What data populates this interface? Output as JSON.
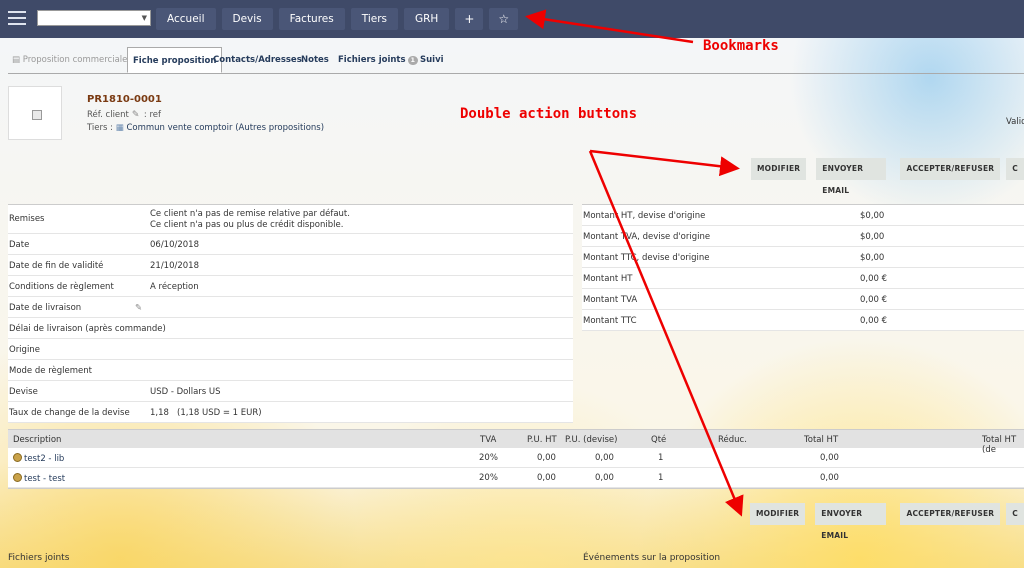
{
  "topbar": {
    "menu": [
      "Accueil",
      "Devis",
      "Factures",
      "Tiers",
      "GRH"
    ],
    "add": "+",
    "bookmark": "☆"
  },
  "tabs": {
    "t1": "Proposition commerciale",
    "t2": "Fiche proposition",
    "t3": "Contacts/Adresses",
    "t4": "Notes",
    "t5": "Fichiers joints",
    "t5_badge": "1",
    "t6": "Suivi"
  },
  "header": {
    "ref": "PR1810-0001",
    "ref_client_label": "Réf. client",
    "ref_client_value": ": ref",
    "tiers_label": "Tiers :",
    "tiers_name": "Commun vente comptoir",
    "tiers_link": "(Autres propositions)",
    "status": "Valid"
  },
  "actions": {
    "modifier": "MODIFIER",
    "envoyer": "ENVOYER EMAIL",
    "accepter": "ACCEPTER/REFUSER",
    "more": "C"
  },
  "info": {
    "remises_label": "Remises",
    "remises_v1": "Ce client n'a pas de remise relative par défaut.",
    "remises_v2": "Ce client n'a pas ou plus de crédit disponible.",
    "date_label": "Date",
    "date": "06/10/2018",
    "fin_label": "Date de fin de validité",
    "fin": "21/10/2018",
    "cond_label": "Conditions de règlement",
    "cond": "A réception",
    "livr_label": "Date de livraison",
    "delai_label": "Délai de livraison (après commande)",
    "origine_label": "Origine",
    "mode_label": "Mode de règlement",
    "devise_label": "Devise",
    "devise": "USD - Dollars US",
    "taux_label": "Taux de change de la devise",
    "taux": "1,18   (1,18 USD = 1 EUR)"
  },
  "totals": [
    {
      "k": "Montant HT, devise d'origine",
      "v": "$0,00"
    },
    {
      "k": "Montant TVA, devise d'origine",
      "v": "$0,00"
    },
    {
      "k": "Montant TTC, devise d'origine",
      "v": "$0,00"
    },
    {
      "k": "Montant HT",
      "v": "0,00 €"
    },
    {
      "k": "Montant TVA",
      "v": "0,00 €"
    },
    {
      "k": "Montant TTC",
      "v": "0,00 €"
    }
  ],
  "lines": {
    "head": {
      "desc": "Description",
      "tva": "TVA",
      "puht": "P.U. HT",
      "pudev": "P.U. (devise)",
      "qte": "Qté",
      "reduc": "Réduc.",
      "total": "Total HT",
      "totaldev": "Total HT (de"
    },
    "rows": [
      {
        "desc": "test2 - lib",
        "tva": "20%",
        "puht": "0,00",
        "pudev": "0,00",
        "qte": "1",
        "total": "0,00"
      },
      {
        "desc": "test - test",
        "tva": "20%",
        "puht": "0,00",
        "pudev": "0,00",
        "qte": "1",
        "total": "0,00"
      }
    ]
  },
  "sections": {
    "files": "Fichiers joints",
    "events": "Événements sur la proposition"
  },
  "annotations": {
    "bookmarks": "Bookmarks",
    "double": "Double action buttons",
    "color": "#ee0000"
  }
}
